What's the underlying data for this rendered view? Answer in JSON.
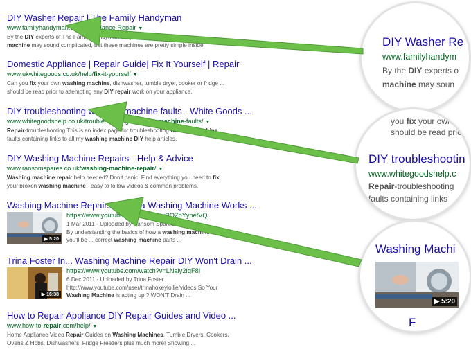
{
  "results": [
    {
      "title": "DIY Washer Repair | The Family Handyman",
      "url": "www.familyhandyman.com › Appliance Repair",
      "snippet1_html": "By the <b>DIY</b> experts of The Family Handyman Magazine. A <b>washing</b>",
      "snippet2_html": "<b>machine</b> may sound complicated, but these machines are pretty simple inside."
    },
    {
      "title": "Domestic Appliance | Repair Guide| Fix It Yourself | Repair",
      "url_html": "www.ukwhitegoods.co.uk/help/<b>fix</b>-it-yourself",
      "snippet1_html": "Can you <b>fix</b> your own <b>washing machine</b>, dishwasher, tumble dryer, cooker or fridge ...",
      "snippet2_html": "should be read prior to attempting any <b>DIY repair</b> work on your appliance."
    },
    {
      "title": "DIY troubleshooting washing machine faults - White Goods ...",
      "url_html": "www.whitegoodshelp.co.uk/troubleshooting-<b>washing-machine</b>-faults/",
      "snippet1_html": "<b>Repair</b>-troubleshooting This is an index page for troubleshooting <b>washing machine</b>",
      "snippet2_html": "faults containing links to all my <b>washing machine DIY</b> help articles."
    },
    {
      "title": "DIY Washing Machine Repairs - Help & Advice",
      "url_html": "www.ransomspares.co.uk/<b>washing-machine-repair</b>/",
      "snippet1_html": "<b>Washing machine repair</b> help needed? Don't panic. Find everything you need to <b>fix</b>",
      "snippet2_html": "your broken <b>washing machine</b> - easy to follow videos &amp; common problems."
    },
    {
      "title": "Washing Machine Repairs - How a Washing Machine Works ...",
      "url": "https://www.youtube.com/watch?v=3OZbYypefVQ",
      "meta": "1 Mar 2011 - Uploaded by Ransom Spares",
      "snippet1_html": "By understanding the basics of how a <b>washing machine</b> works,",
      "snippet2_html": "you'll be ... correct <b>washing machine</b> parts ...",
      "duration": "5:20"
    },
    {
      "title": "Trina Foster In... Washing Machine Repair DIY Won't Drain ...",
      "url": "https://www.youtube.com/watch?v=LNaly2IqF8I",
      "meta": "6 Dec 2011 - Uploaded by Trina Foster",
      "snippet1_html": "http://www.youtube.com/user/trinahokeylollie/videos So Your",
      "snippet2_html": "<b>Washing Machine</b> is acting up ? WON'T Drain ...",
      "duration": "16:38"
    },
    {
      "title": "How to Repair Appliance DIY Repair Guides and Video ...",
      "url_html": "www.how-to-<b>repair</b>.com/help/",
      "snippet1_html": "Home Appliance Video <b>Repair</b> Guides on <b>Washing Machines</b>, Tumble Dryers, Cookers,",
      "snippet2_html": "Ovens &amp; Hobs, Dishwashers, Fridge Freezers plus much more! Showing ..."
    }
  ],
  "zoom1": {
    "title": "DIY Washer Re",
    "url": "www.familyhandym",
    "line1_html": "By the <b>DIY</b> experts o",
    "line2_html": "<b>machine</b> may soun"
  },
  "zoom2": {
    "top_html": "you <b>fix</b> your own",
    "top2": "should be read prior to",
    "title": "DIY troubleshootin",
    "url": "www.whitegoodshelp.c",
    "line1_html": "<b>Repair</b>-troubleshooting",
    "line2": "faults containing links"
  },
  "zoom3": {
    "title": "Washing Machi",
    "duration": "5:20",
    "bottom": "F"
  },
  "colors": {
    "title": "#1a0dab",
    "url": "#006621",
    "snippet": "#545454",
    "arrow": "#6cc04a"
  }
}
